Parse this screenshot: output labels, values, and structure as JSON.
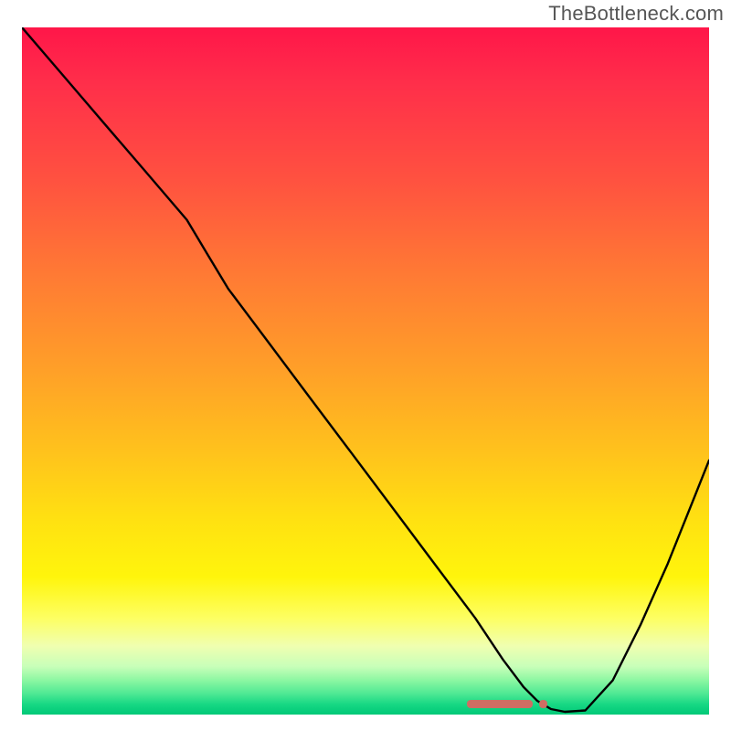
{
  "watermark": "TheBottleneck.com",
  "chart_data": {
    "type": "line",
    "title": "",
    "xlabel": "",
    "ylabel": "",
    "xlim": [
      0,
      100
    ],
    "ylim": [
      0,
      100
    ],
    "grid": false,
    "series": [
      {
        "name": "curve",
        "x": [
          0,
          6,
          12,
          18,
          24,
          27,
          30,
          36,
          42,
          48,
          54,
          60,
          66,
          70,
          73,
          75,
          77,
          79,
          82,
          86,
          90,
          94,
          98,
          100
        ],
        "values": [
          100,
          93,
          86,
          79,
          72,
          67,
          62,
          54,
          46,
          38,
          30,
          22,
          14,
          8,
          4,
          2,
          0.8,
          0.4,
          0.6,
          5,
          13,
          22,
          32,
          37
        ]
      }
    ],
    "gradient_colors_top_to_bottom": [
      "#ff1649",
      "#ff5140",
      "#ffa028",
      "#ffe211",
      "#fdff63",
      "#c8ffb9",
      "#17d884"
    ],
    "markers": [
      {
        "type": "bar",
        "x_center_pct": 69.5,
        "y_pct": 1.5,
        "width_pct": 9.5,
        "color": "#cf6d63"
      },
      {
        "type": "dot",
        "x_center_pct": 76.0,
        "y_pct": 1.5,
        "color": "#cf6d63"
      }
    ]
  }
}
